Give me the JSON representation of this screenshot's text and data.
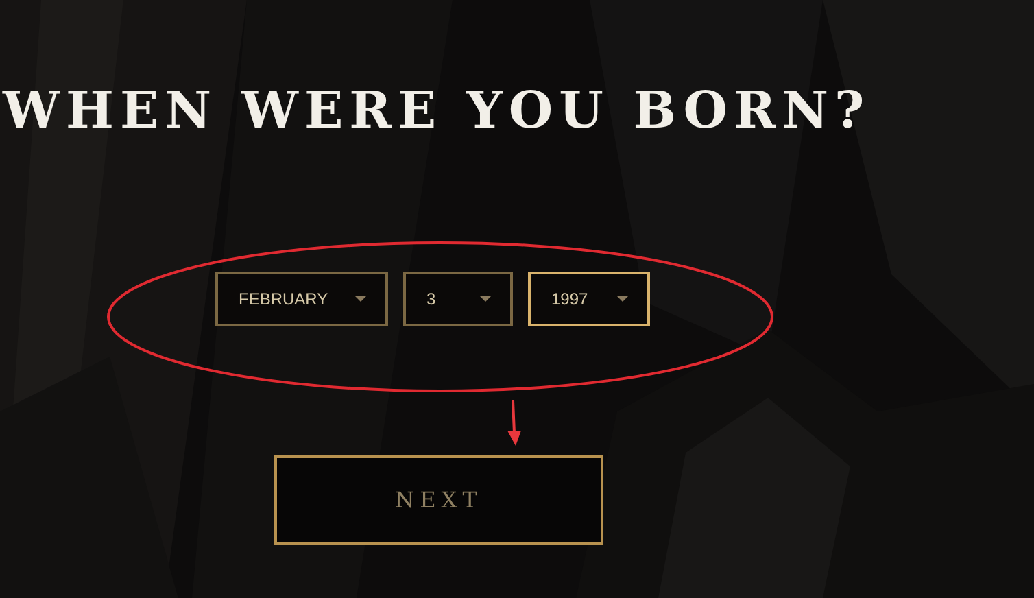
{
  "heading": "WHEN WERE YOU BORN?",
  "date_selects": [
    {
      "value": "FEBRUARY",
      "focused": false
    },
    {
      "value": "3",
      "focused": false
    },
    {
      "value": "1997",
      "focused": true
    }
  ],
  "next_button": {
    "label": "NEXT"
  }
}
